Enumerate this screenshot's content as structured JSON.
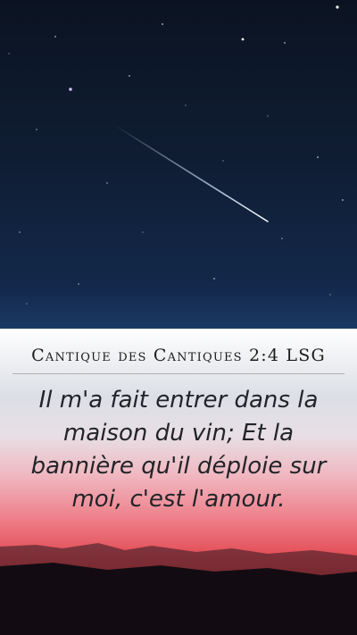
{
  "reference": "Cantique des Cantiques 2:4 LSG",
  "verse": "Il m'a fait entrer dans la maison du vin; Et la bannière qu'il déploie sur moi, c'est l'amour.",
  "colors": {
    "sky": "#0f1d33",
    "sunset": "#e24a52",
    "text": "#222428"
  },
  "background": {
    "top": "night-sky-with-shooting-star",
    "bottom": "sunset-horizon"
  }
}
